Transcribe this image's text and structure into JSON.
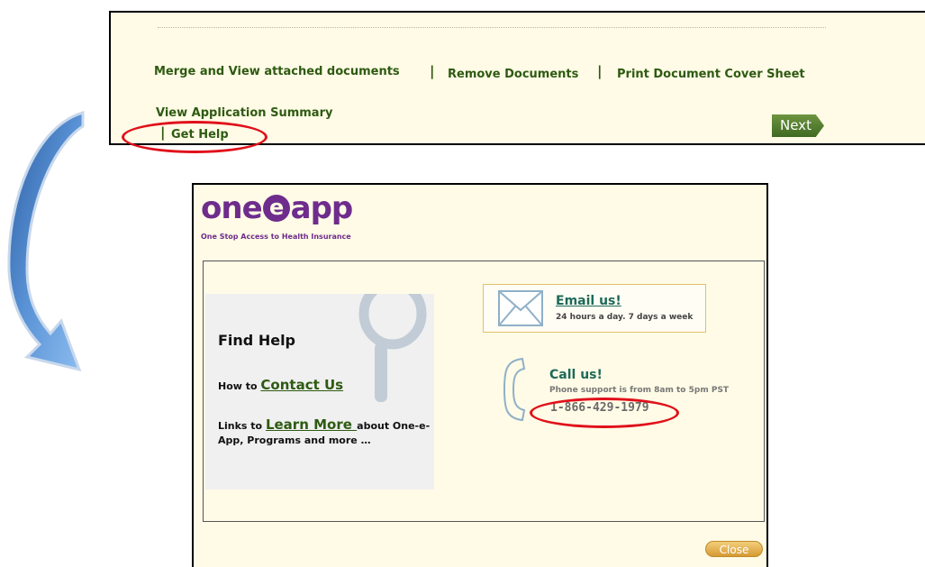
{
  "top_panel": {
    "link_merge": "Merge and View attached documents",
    "separator_1": "|",
    "link_remove": "Remove Documents",
    "separator_2": "|",
    "link_print": "Print Document Cover Sheet",
    "link_summary": "View Application Summary",
    "separator_3": "|",
    "link_help": "Get Help",
    "next_label": "Next"
  },
  "popup": {
    "logo_left": "one",
    "logo_e": "e",
    "logo_right": "app",
    "tagline": "One Stop Access to Health Insurance",
    "find_help_title": "Find Help",
    "how_to_prefix": "How to ",
    "contact_link": "Contact Us",
    "links_prefix": "Links to ",
    "learn_more_link": "Learn More ",
    "links_suffix": "about One-e-App, Programs and more …",
    "email_title": "Email us!",
    "email_subtitle": "24 hours a day. 7 days a week",
    "call_title": "Call us!",
    "call_subtitle": "Phone support is from 8am to 5pm PST",
    "phone_number": "1-866-429-1979",
    "close_label": "Close"
  },
  "colors": {
    "link_green": "#2e5a12",
    "brand_purple": "#6e2c8c",
    "highlight_red": "#e0101a",
    "panel_bg": "#fffbe6",
    "arrow_blue": "#3f78c0"
  },
  "icons": [
    "curved-arrow-icon",
    "envelope-icon",
    "phone-icon",
    "magnifier-icon"
  ]
}
